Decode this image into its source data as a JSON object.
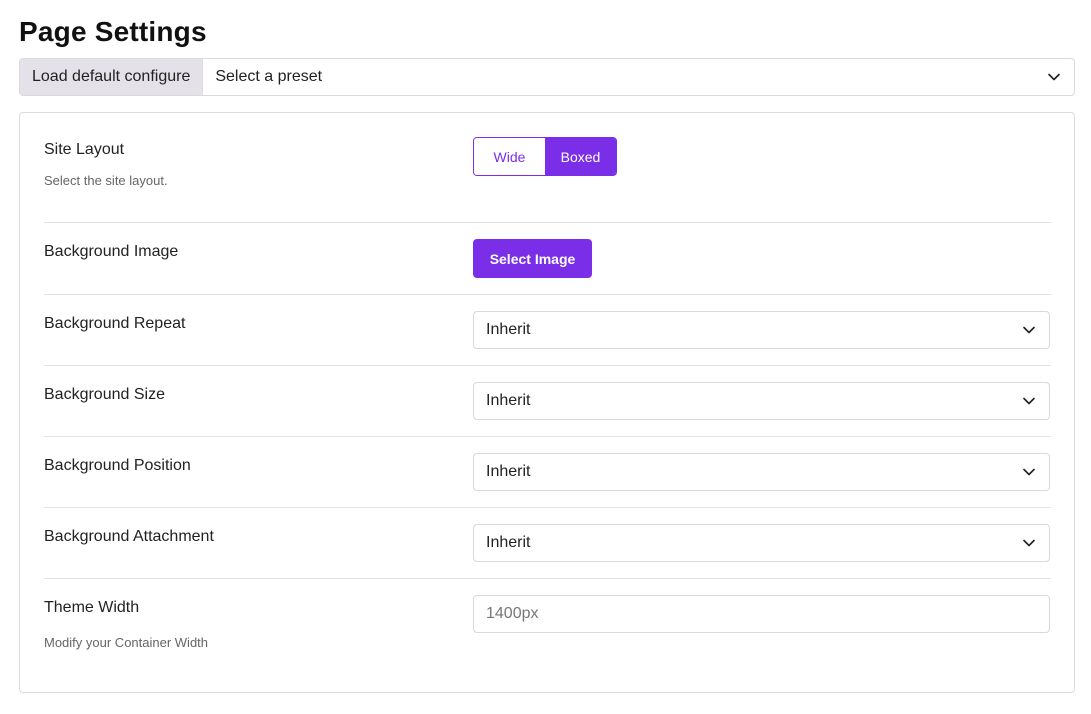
{
  "page": {
    "title": "Page Settings"
  },
  "preset": {
    "label": "Load default configure",
    "placeholder": "Select a preset"
  },
  "settings": {
    "site_layout": {
      "label": "Site Layout",
      "help": "Select the site layout.",
      "options": [
        "Wide",
        "Boxed"
      ],
      "selected": "Boxed"
    },
    "background_image": {
      "label": "Background Image",
      "button": "Select Image"
    },
    "background_repeat": {
      "label": "Background Repeat",
      "value": "Inherit"
    },
    "background_size": {
      "label": "Background Size",
      "value": "Inherit"
    },
    "background_position": {
      "label": "Background Position",
      "value": "Inherit"
    },
    "background_attachment": {
      "label": "Background Attachment",
      "value": "Inherit"
    },
    "theme_width": {
      "label": "Theme Width",
      "help": "Modify your Container Width",
      "placeholder": "1400px"
    }
  },
  "colors": {
    "accent": "#7a2ee8",
    "border": "#d9d9de",
    "preset_label_bg": "#e4e1e8"
  },
  "icons": {
    "dropdown": "chevron-down-icon"
  }
}
